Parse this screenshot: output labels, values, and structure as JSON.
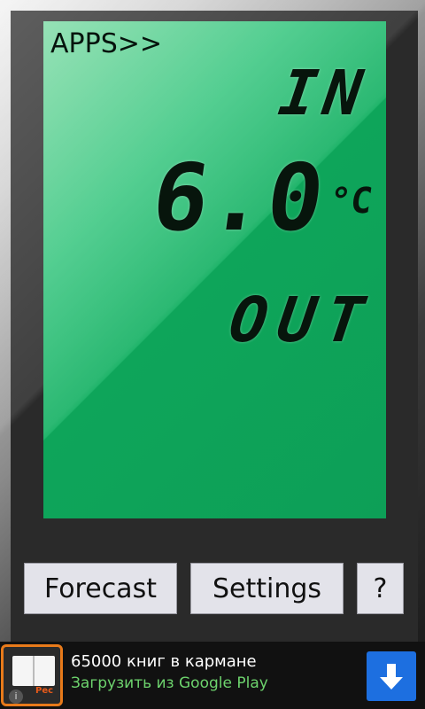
{
  "display": {
    "apps_label": "APPS>>",
    "top_label": "IN",
    "temperature": "6.0",
    "unit": "°C",
    "bottom_label": "OUT"
  },
  "buttons": {
    "forecast_label": "Forecast",
    "settings_label": "Settings",
    "help_label": "?"
  },
  "ad": {
    "title": "65000 книг в кармане",
    "subtitle": "Загрузить из Google Play",
    "icon_text": "Рес",
    "info_glyph": "i",
    "download_icon": "download-arrow-icon"
  },
  "colors": {
    "lcd_green": "#0ea55a",
    "ad_subtitle": "#6dd36d",
    "download_button": "#1d6fe0",
    "icon_border": "#e87a1a"
  }
}
